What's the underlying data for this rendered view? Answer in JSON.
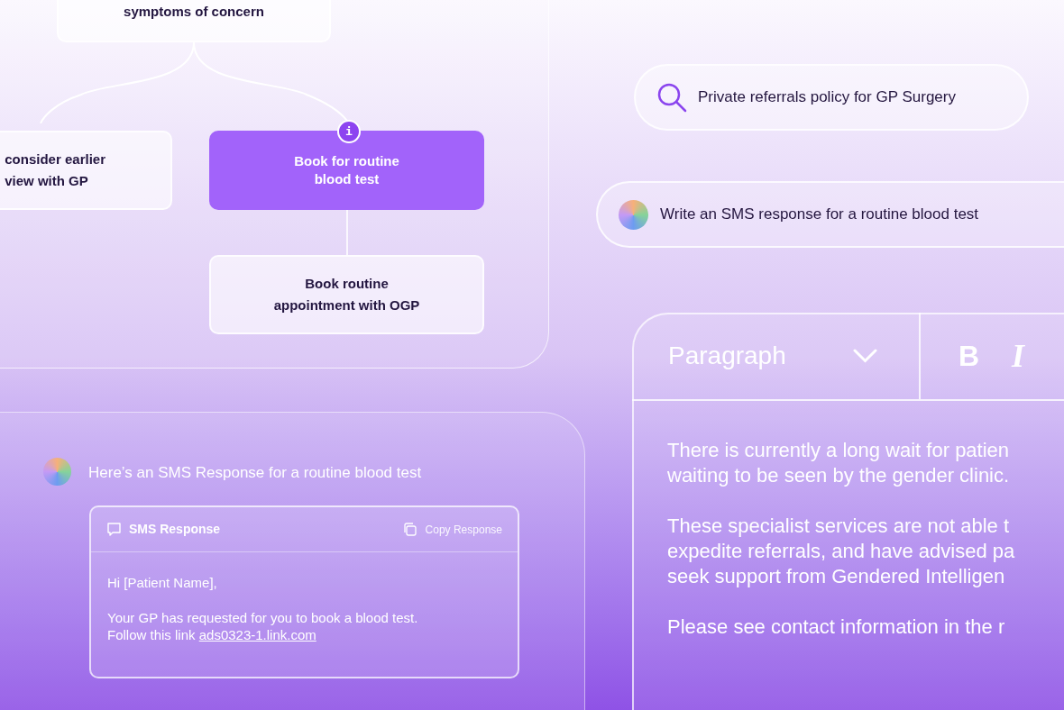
{
  "flowchart": {
    "nodes": [
      {
        "text": "symptoms of concern",
        "highlighted": false
      },
      {
        "text": "consider earlier\nview with GP",
        "highlighted": false
      },
      {
        "text": "Book for routine\nblood test",
        "highlighted": true,
        "badge": "i"
      },
      {
        "text": "Book routine\nappointment with OGP",
        "highlighted": false
      }
    ]
  },
  "chat": {
    "message": "Here’s an SMS Response for a routine blood test",
    "card": {
      "title": "SMS Response",
      "action": "Copy Response",
      "paragraphs": [
        {
          "text": "Hi [Patient Name],"
        },
        {
          "text": "Your GP has requested for you to book a blood test.\nFollow this link ",
          "link": "ads0323-1.link.com"
        }
      ]
    }
  },
  "search": {
    "value": "Private referrals policy for GP Surgery"
  },
  "prompt": {
    "value": "Write an SMS response for a routine blood test"
  },
  "editor": {
    "format": "Paragraph",
    "buttons": [
      {
        "label": "B",
        "kind": "bold"
      },
      {
        "label": "I",
        "kind": "italic"
      }
    ],
    "paragraphs": [
      "There is currently a long wait for patien\nwaiting to be seen by the gender clinic.",
      "These specialist services are not able t\nexpedite referrals, and have advised pa\nseek support from Gendered Intelligen",
      "Please see contact information in the r"
    ]
  }
}
